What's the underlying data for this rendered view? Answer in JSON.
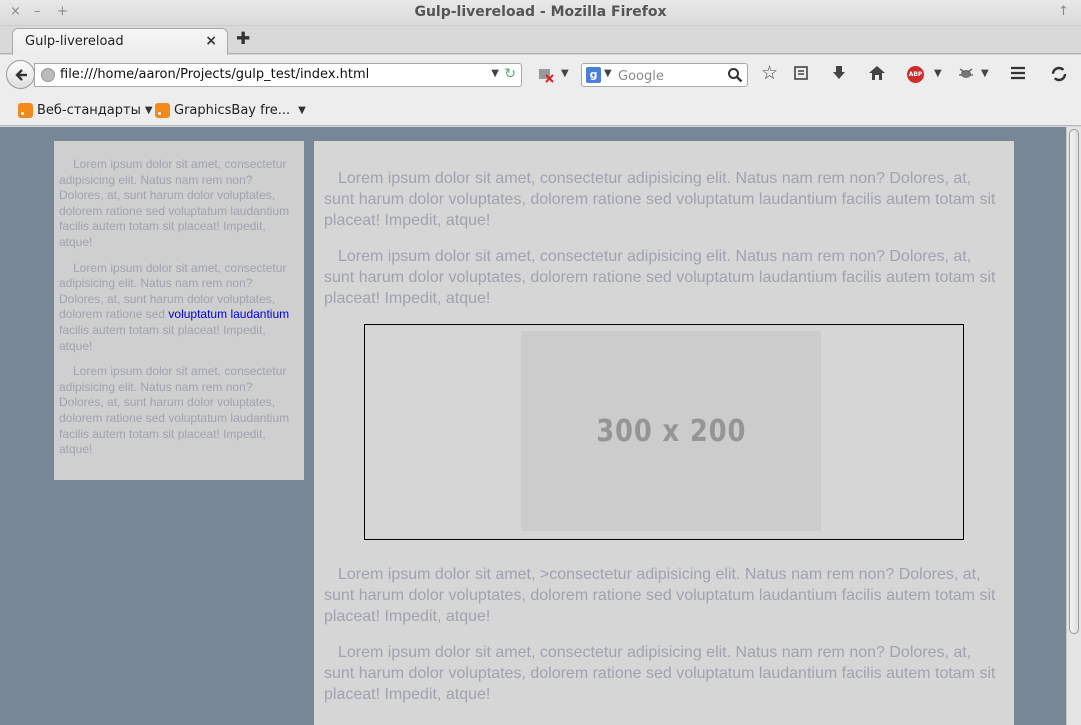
{
  "window": {
    "title": "Gulp-livereload - Mozilla Firefox",
    "controls": [
      "×",
      "–",
      "+"
    ],
    "pin_glyph": "↑"
  },
  "tabs": [
    {
      "label": "Gulp-livereload",
      "close": "×"
    }
  ],
  "newtab_glyph": "✚",
  "navbar": {
    "url": "file:///home/aaron/Projects/gulp_test/index.html",
    "search_placeholder": "Google",
    "search_engine_letter": "g",
    "abp_label": "ABP"
  },
  "bookmarks": [
    {
      "label": "Веб-стандарты"
    },
    {
      "label": "GraphicsBay fre..."
    }
  ],
  "sidebar": {
    "paragraphs": [
      "Lorem ipsum dolor sit amet, consectetur adipisicing elit. Natus nam rem non? Dolores, at, sunt harum dolor voluptates, dolorem ratione sed voluptatum laudantium facilis autem totam sit placeat! Impedit, atque!",
      {
        "before": "Lorem ipsum dolor sit amet, consectetur adipisicing elit. Natus nam rem non? Dolores, at, sunt harum dolor voluptates, dolorem ratione sed ",
        "link": "voluptatum laudantium",
        "after": " facilis autem totam sit placeat! Impedit, atque!"
      },
      "Lorem ipsum dolor sit amet, consectetur adipisicing elit. Natus nam rem non? Dolores, at, sunt harum dolor voluptates, dolorem ratione sed voluptatum laudantium facilis autem totam sit placeat! Impedit, atque!"
    ]
  },
  "main": {
    "paragraphs_top": [
      "Lorem ipsum dolor sit amet, consectetur adipisicing elit. Natus nam rem non? Dolores, at, sunt harum dolor voluptates, dolorem ratione sed voluptatum laudantium facilis autem totam sit placeat! Impedit, atque!",
      "Lorem ipsum dolor sit amet, consectetur adipisicing elit. Natus nam rem non? Dolores, at, sunt harum dolor voluptates, dolorem ratione sed voluptatum laudantium facilis autem totam sit placeat! Impedit, atque!"
    ],
    "image_placeholder": "300 x 200",
    "paragraphs_bottom": [
      "Lorem ipsum dolor sit amet, >consectetur adipisicing elit. Natus nam rem non? Dolores, at, sunt harum dolor voluptates, dolorem ratione sed voluptatum laudantium facilis autem totam sit placeat! Impedit, atque!",
      "Lorem ipsum dolor sit amet, consectetur adipisicing elit. Natus nam rem non? Dolores, at, sunt harum dolor voluptates, dolorem ratione sed voluptatum laudantium facilis autem totam sit placeat! Impedit, atque!"
    ]
  },
  "colors": {
    "page_background": "#788796",
    "panel_background": "#d6d6d6",
    "sidebar_background": "#cfcfcf",
    "text": "#9fa3ad",
    "link": "#0000ee"
  }
}
